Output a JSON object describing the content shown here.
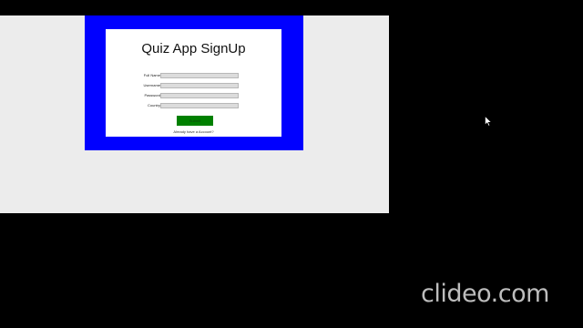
{
  "form": {
    "title": "Quiz App SignUp",
    "fields": [
      {
        "label": "Full Name",
        "value": ""
      },
      {
        "label": "Username",
        "value": ""
      },
      {
        "label": "Password",
        "value": ""
      },
      {
        "label": "Country",
        "value": ""
      }
    ],
    "submit_label": "Submit",
    "login_link": "Already have a Account?"
  },
  "watermark": {
    "text": "clideo.com"
  },
  "colors": {
    "frame_blue": "#0000ff",
    "submit_green": "#008000",
    "window_bg": "#ececec",
    "screen_bg": "#000000"
  },
  "icons": {
    "cursor": "mouse-pointer-icon"
  }
}
